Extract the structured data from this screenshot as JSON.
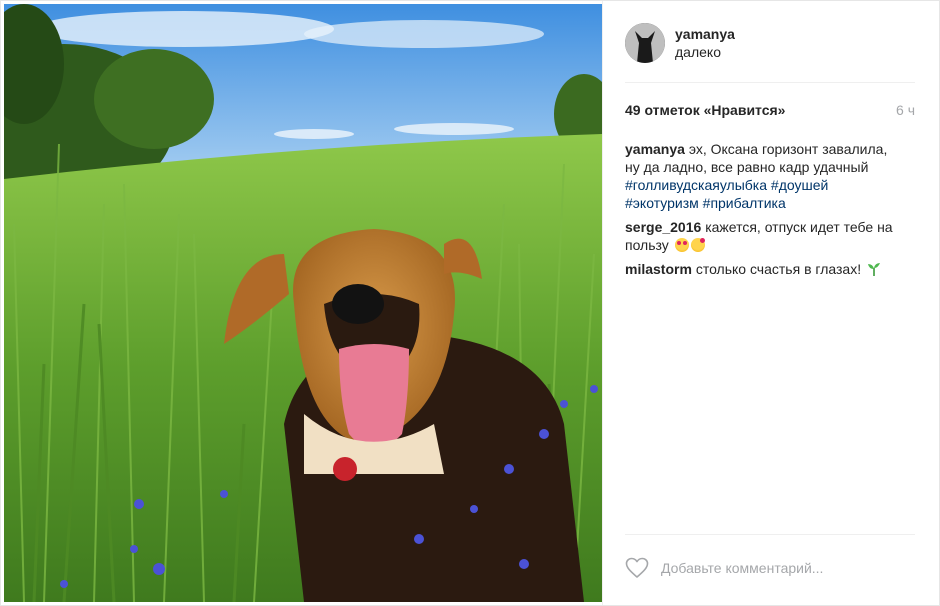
{
  "post": {
    "username": "yamanya",
    "location": "далеко",
    "likes": "49 отметок «Нравится»",
    "time_ago": "6 ч"
  },
  "comments": [
    {
      "user": "yamanya",
      "text": "эх, Оксана горизонт завалила, ну да ладно, все равно кадр удачный",
      "tags": [
        "#голливудскаяулыбка",
        "#доушей",
        "#экотуризм",
        "#прибалтика"
      ]
    },
    {
      "user": "serge_2016",
      "text": "кажется, отпуск идет тебе на пользу",
      "emojis": [
        "heart-eyes-emoji",
        "kiss-emoji"
      ]
    },
    {
      "user": "milastorm",
      "text": "столько счастья в глазах!",
      "emojis": [
        "seedling-emoji"
      ]
    }
  ],
  "footer": {
    "comment_placeholder": "Добавьте комментарий..."
  },
  "colors": {
    "hashtag": "#003569",
    "muted": "#a5a7aa",
    "text": "#262626"
  }
}
